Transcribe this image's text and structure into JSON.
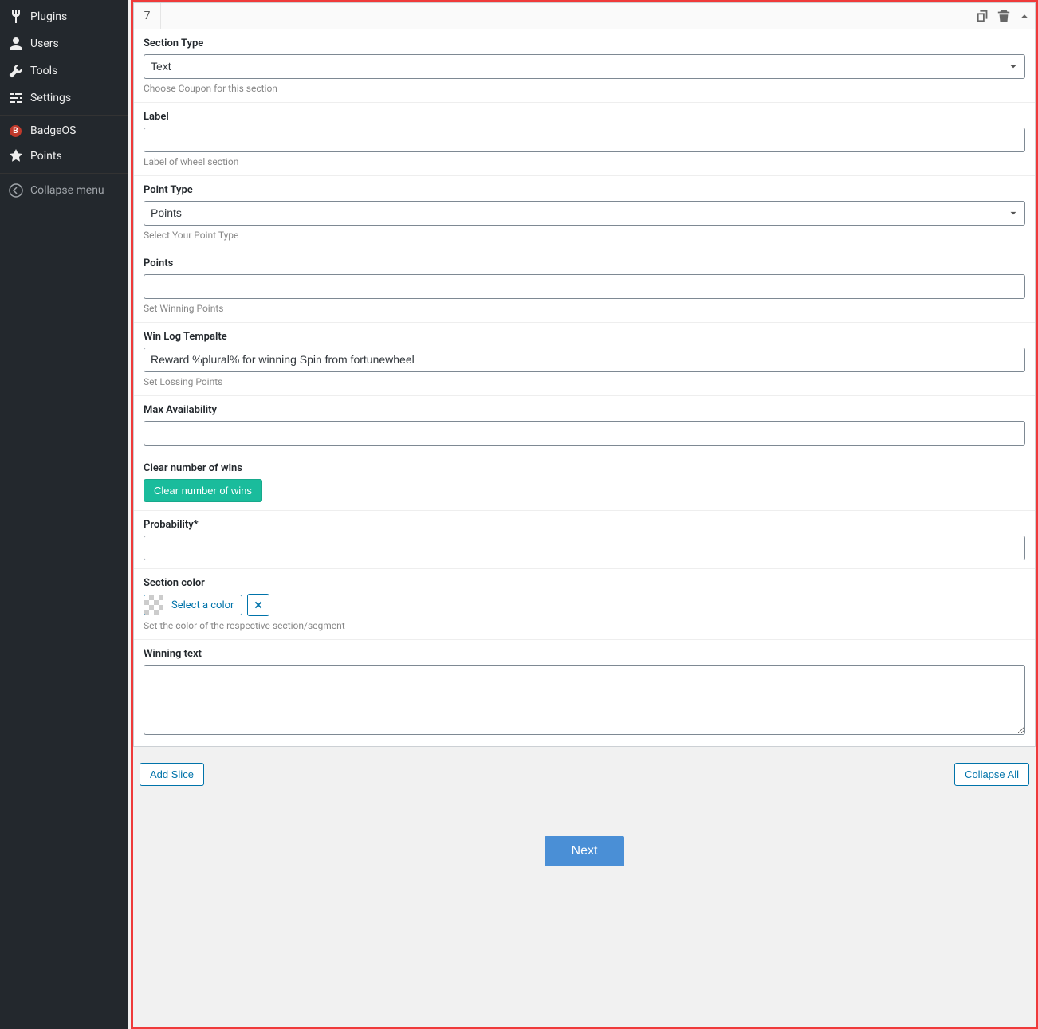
{
  "sidebar": {
    "items": [
      {
        "label": "Plugins",
        "icon": "plugin"
      },
      {
        "label": "Users",
        "icon": "user"
      },
      {
        "label": "Tools",
        "icon": "wrench"
      },
      {
        "label": "Settings",
        "icon": "sliders"
      },
      {
        "label": "BadgeOS",
        "icon": "badgeos"
      },
      {
        "label": "Points",
        "icon": "star"
      },
      {
        "label": "Collapse menu",
        "icon": "collapse"
      }
    ]
  },
  "panel": {
    "number": "7",
    "fields": {
      "section_type": {
        "label": "Section Type",
        "value": "Text",
        "help": "Choose Coupon for this section"
      },
      "label_field": {
        "label": "Label",
        "value": "",
        "help": "Label of wheel section"
      },
      "point_type": {
        "label": "Point Type",
        "value": "Points",
        "help": "Select Your Point Type"
      },
      "points": {
        "label": "Points",
        "value": "",
        "help": "Set Winning Points"
      },
      "win_log": {
        "label": "Win Log Tempalte",
        "value": "Reward %plural% for winning Spin from fortunewheel",
        "help": "Set Lossing Points"
      },
      "max_avail": {
        "label": "Max Availability",
        "value": ""
      },
      "clear_wins": {
        "label": "Clear number of wins",
        "button": "Clear number of wins"
      },
      "probability": {
        "label": "Probability*",
        "value": ""
      },
      "section_color": {
        "label": "Section color",
        "button": "Select a color",
        "help": "Set the color of the respective section/segment"
      },
      "winning_text": {
        "label": "Winning text",
        "value": ""
      }
    }
  },
  "actions": {
    "add_slice": "Add Slice",
    "collapse_all": "Collapse All",
    "next": "Next"
  },
  "icons": {
    "badgeos_letter": "B"
  }
}
